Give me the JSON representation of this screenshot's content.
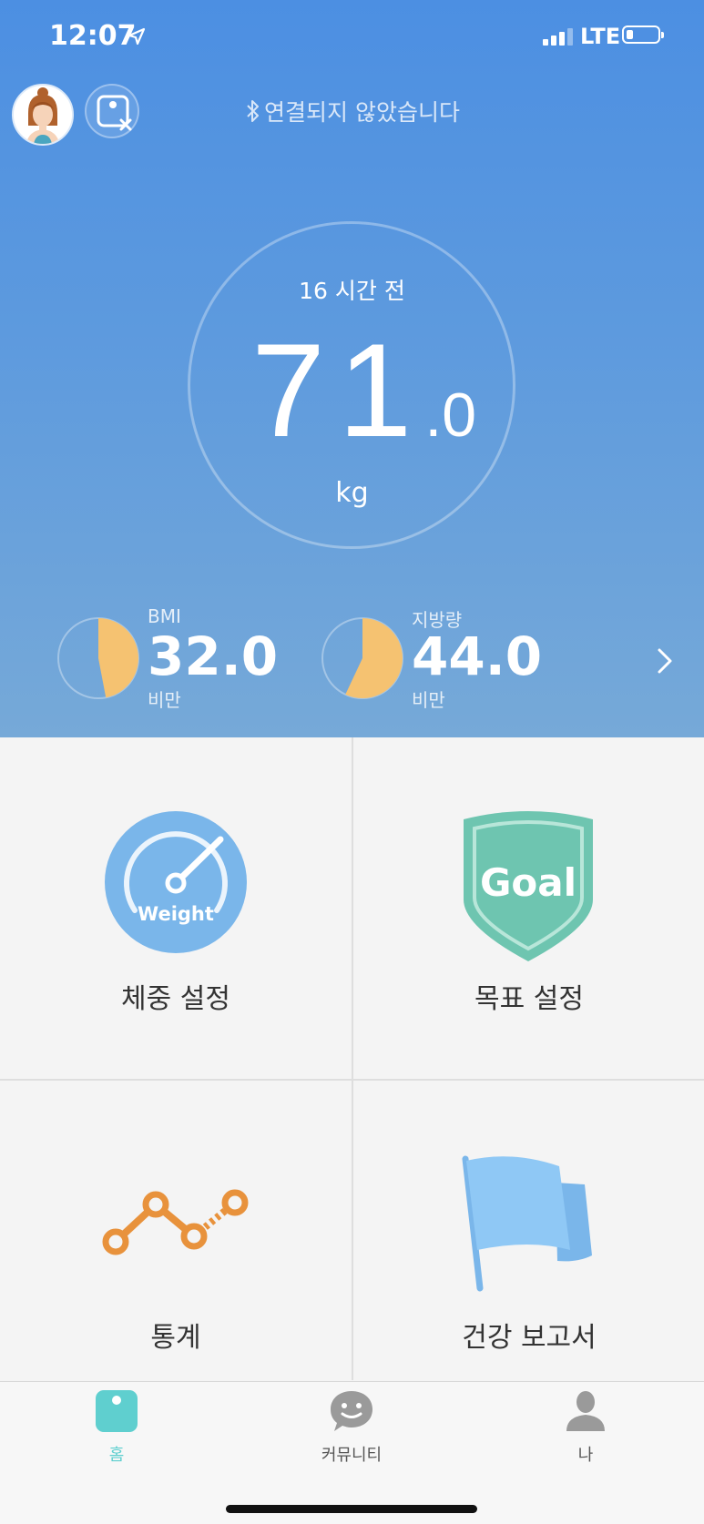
{
  "status_bar": {
    "time": "12:07",
    "network": "LTE",
    "battery_percent": 15
  },
  "header": {
    "connection_status": "연결되지 않았습니다"
  },
  "measurement": {
    "time_ago": "16 시간 전",
    "weight_int": "71",
    "weight_dec": ".0",
    "unit": "kg"
  },
  "metrics": [
    {
      "label": "BMI",
      "value": "32.0",
      "status": "비만",
      "fill_fraction": 0.47,
      "color": "#f5c271"
    },
    {
      "label": "지방량",
      "value": "44.0",
      "status": "비만",
      "fill_fraction": 0.57,
      "color": "#f5c271"
    }
  ],
  "menu": {
    "weight_setting": {
      "label": "체중 설정",
      "icon_text": "Weight",
      "color": "#7ab6ea"
    },
    "goal_setting": {
      "label": "목표 설정",
      "icon_text": "Goal",
      "color": "#6ec5b0"
    },
    "statistics": {
      "label": "통계",
      "color": "#e8923c"
    },
    "health_report": {
      "label": "건강 보고서",
      "color": "#8fc8f5"
    }
  },
  "tabs": [
    {
      "label": "홈",
      "active": true,
      "icon": "scale-icon"
    },
    {
      "label": "커뮤니티",
      "active": false,
      "icon": "chat-smile-icon"
    },
    {
      "label": "나",
      "active": false,
      "icon": "person-icon"
    }
  ],
  "colors": {
    "accent": "#5fcfcf",
    "hero_top": "#4c8fe2",
    "hero_bottom": "#76a9d8"
  }
}
